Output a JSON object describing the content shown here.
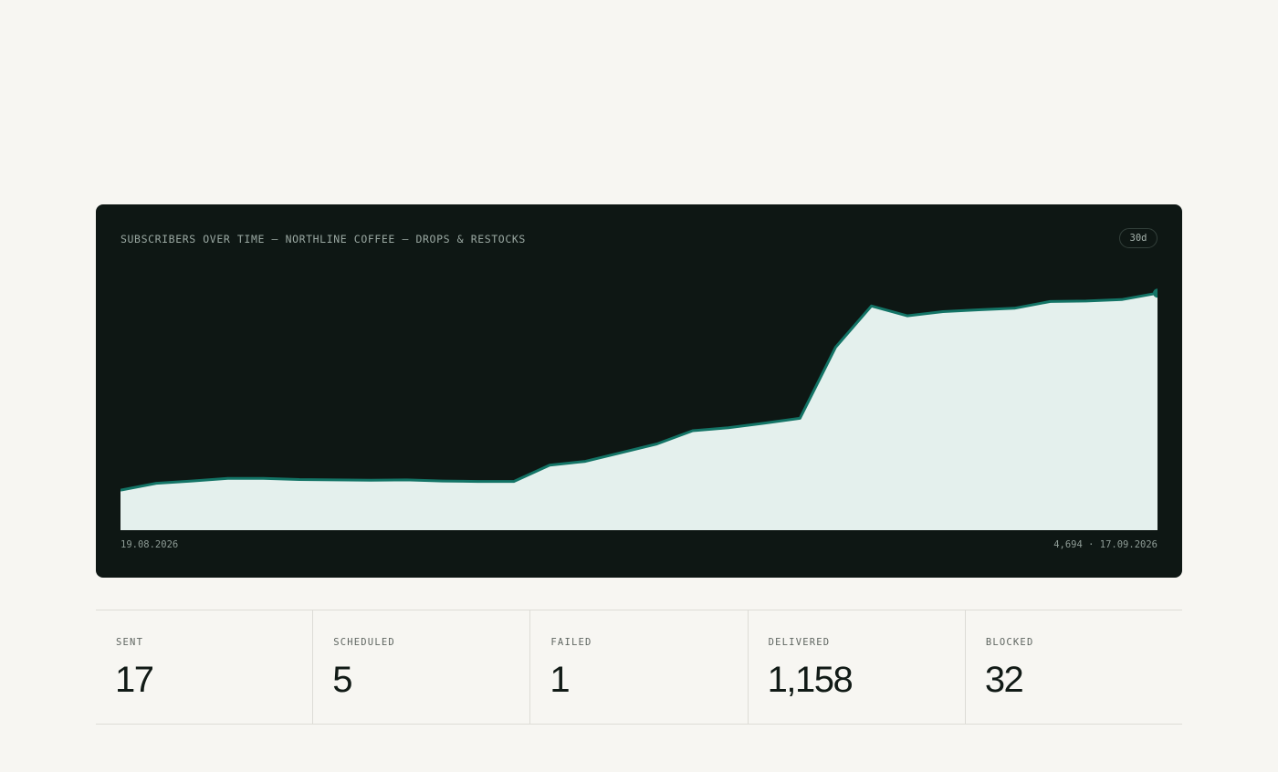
{
  "chart_card": {
    "title": "SUBSCRIBERS OVER TIME — NORTHLINE COFFEE — DROPS & RESTOCKS",
    "range_label": "30d",
    "start_label": "19.08.2026",
    "end_label": "4,694 · 17.09.2026"
  },
  "chart_data": {
    "type": "area",
    "title": "SUBSCRIBERS OVER TIME — NORTHLINE COFFEE — DROPS & RESTOCKS",
    "x_start": "19.08.2026",
    "x_end": "17.09.2026",
    "series": [
      {
        "values": [
          1060,
          1240,
          1300,
          1370,
          1370,
          1340,
          1330,
          1320,
          1330,
          1300,
          1290,
          1290,
          1720,
          1820,
          2050,
          2280,
          2630,
          2710,
          2830,
          2960,
          4840,
          5930,
          5670,
          5780,
          5830,
          5870,
          6050,
          6060,
          6100,
          6270
        ]
      }
    ],
    "colors": {
      "line": "#137466",
      "fill": "#e4f0ed",
      "background": "#0e1714"
    }
  },
  "stats": [
    {
      "label": "SENT",
      "value": "17"
    },
    {
      "label": "SCHEDULED",
      "value": "5"
    },
    {
      "label": "FAILED",
      "value": "1"
    },
    {
      "label": "DELIVERED",
      "value": "1,158"
    },
    {
      "label": "BLOCKED",
      "value": "32"
    }
  ]
}
